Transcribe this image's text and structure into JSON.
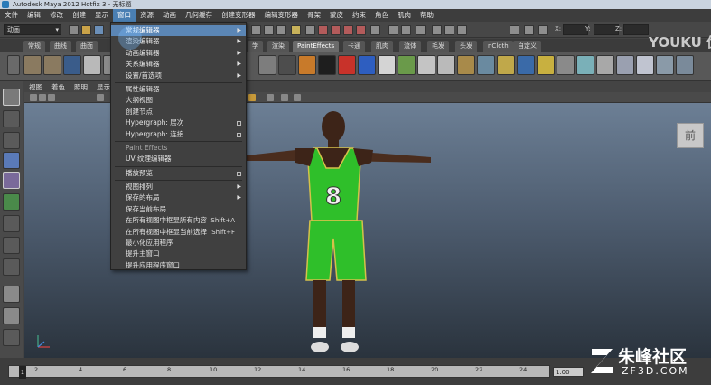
{
  "window": {
    "title": "Autodesk Maya 2012 Hotfix 3 - 无标题"
  },
  "menubar": [
    "文件",
    "编辑",
    "修改",
    "创建",
    "显示",
    "窗口",
    "资源",
    "动画",
    "几何缓存",
    "创建变形器",
    "编辑变形器",
    "骨架",
    "蒙皮",
    "约束",
    "角色",
    "肌肉",
    "帮助"
  ],
  "menubar_active": "窗口",
  "statusline": {
    "mode": "动画",
    "x_label": "X:",
    "y_label": "Y:",
    "z_label": "Z:"
  },
  "shelf": {
    "tabs": [
      "常规",
      "曲线",
      "曲面",
      "多边形",
      "细分曲面",
      "变形",
      "动画",
      "动力学",
      "渲染",
      "PaintEffects",
      "卡通",
      "肌肉",
      "流体",
      "毛发",
      "头发",
      "nCloth",
      "自定义"
    ],
    "active_tab": "PaintEffects",
    "visible_tabs": [
      "常规",
      "曲线",
      "曲面",
      "学",
      "渲染",
      "PaintEffects",
      "卡通",
      "肌肉",
      "流体",
      "毛发",
      "头发",
      "nCloth",
      "自定义"
    ]
  },
  "panel_menu": [
    "视图",
    "着色",
    "照明",
    "显示"
  ],
  "window_menu": {
    "items": [
      {
        "label": "常规编辑器",
        "type": "submenu",
        "highlight": true
      },
      {
        "label": "渲染编辑器",
        "type": "submenu"
      },
      {
        "label": "动画编辑器",
        "type": "submenu"
      },
      {
        "label": "关系编辑器",
        "type": "submenu"
      },
      {
        "label": "设置/首选项",
        "type": "submenu"
      },
      {
        "label": "属性编辑器",
        "type": "plain"
      },
      {
        "label": "大纲视图",
        "type": "plain"
      },
      {
        "label": "创建节点",
        "type": "plain"
      },
      {
        "label": "Hypergraph: 层次",
        "type": "option"
      },
      {
        "label": "Hypergraph: 连接",
        "type": "option"
      },
      {
        "label": "Paint Effects",
        "type": "plain",
        "gray": true
      },
      {
        "label": "UV 纹理编辑器",
        "type": "plain"
      },
      {
        "label": "播放预览",
        "type": "option"
      },
      {
        "label": "视图排列",
        "type": "submenu"
      },
      {
        "label": "保存的布局",
        "type": "submenu"
      },
      {
        "label": "保存当前布局...",
        "type": "plain"
      },
      {
        "label": "在所有视图中框显所有内容",
        "type": "shortcut",
        "shortcut": "Shift+A"
      },
      {
        "label": "在所有视图中框显当前选择",
        "type": "shortcut",
        "shortcut": "Shift+F"
      },
      {
        "label": "最小化应用程序",
        "type": "plain"
      },
      {
        "label": "提升主窗口",
        "type": "plain"
      },
      {
        "label": "提升应用程序窗口",
        "type": "plain"
      }
    ]
  },
  "viewport": {
    "viewcube_label": "前",
    "jersey_number": "8",
    "watermark": "YOUKU 优酷"
  },
  "timeline": {
    "ticks": [
      "2",
      "4",
      "6",
      "8",
      "10",
      "12",
      "14",
      "16",
      "18",
      "20",
      "22",
      "24"
    ],
    "current_frame": "1",
    "frame_field": "1.00"
  },
  "branding": {
    "title": "朱峰社区",
    "subtitle": "ZF3D.COM"
  },
  "colors": {
    "menu_highlight": "#5b86b5",
    "jersey": "#2fbf2a",
    "skin": "#4a2d1e"
  }
}
